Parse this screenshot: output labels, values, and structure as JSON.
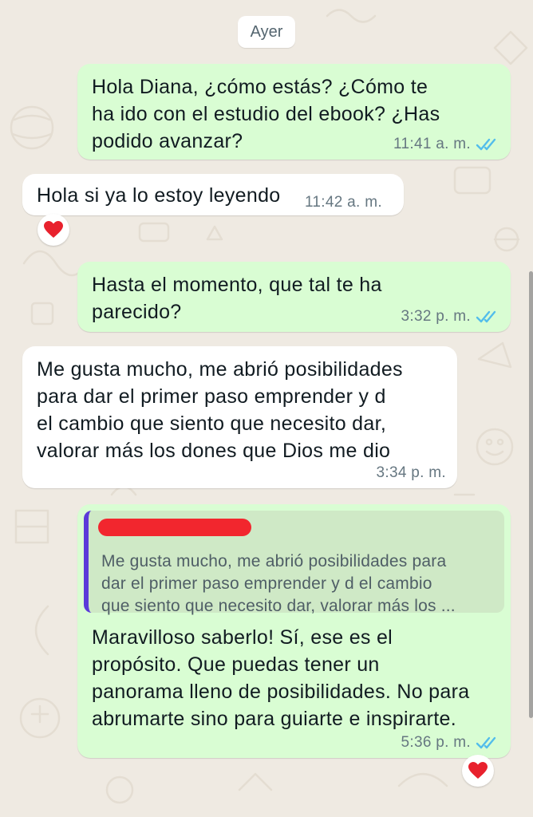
{
  "chat": {
    "date_separator": "Ayer",
    "messages": [
      {
        "direction": "outgoing",
        "text": "Hola Diana, ¿cómo estás? ¿Cómo te\nha ido con el estudio del ebook? ¿Has\npodido avanzar?",
        "time": "11:41 a. m.",
        "status": "read"
      },
      {
        "direction": "incoming",
        "text": "Hola si ya lo estoy leyendo",
        "time": "11:42 a. m.",
        "reaction": "heart"
      },
      {
        "direction": "outgoing",
        "text": "Hasta el momento, que tal te ha\nparecido?",
        "time": "3:32 p. m.",
        "status": "read"
      },
      {
        "direction": "incoming",
        "text": "Me gusta mucho, me abrió posibilidades\npara  dar el primer paso emprender y d\nel cambio que siento que necesito dar,\nvalorar más los dones que Dios me dio",
        "time": "3:34 p. m."
      },
      {
        "direction": "outgoing",
        "quoted_text": "Me gusta mucho, me abrió posibilidades para\ndar el primer paso emprender y d el cambio\nque siento que necesito dar, valorar más los ...",
        "text": "Maravilloso saberlo! Sí, ese es el\npropósito. Que puedas tener un\npanorama lleno de posibilidades. No para\nabrumarte sino para guiarte e inspirarte.",
        "time": "5:36 p. m.",
        "status": "read",
        "reaction": "heart"
      }
    ]
  },
  "colors": {
    "outgoing_bubble": "#d9fdd3",
    "incoming_bubble": "#ffffff",
    "read_ticks": "#53bdeb",
    "reaction_heart": "#e8212d",
    "quote_bar": "#5b3bd9",
    "redacted_name": "#f2262e"
  }
}
